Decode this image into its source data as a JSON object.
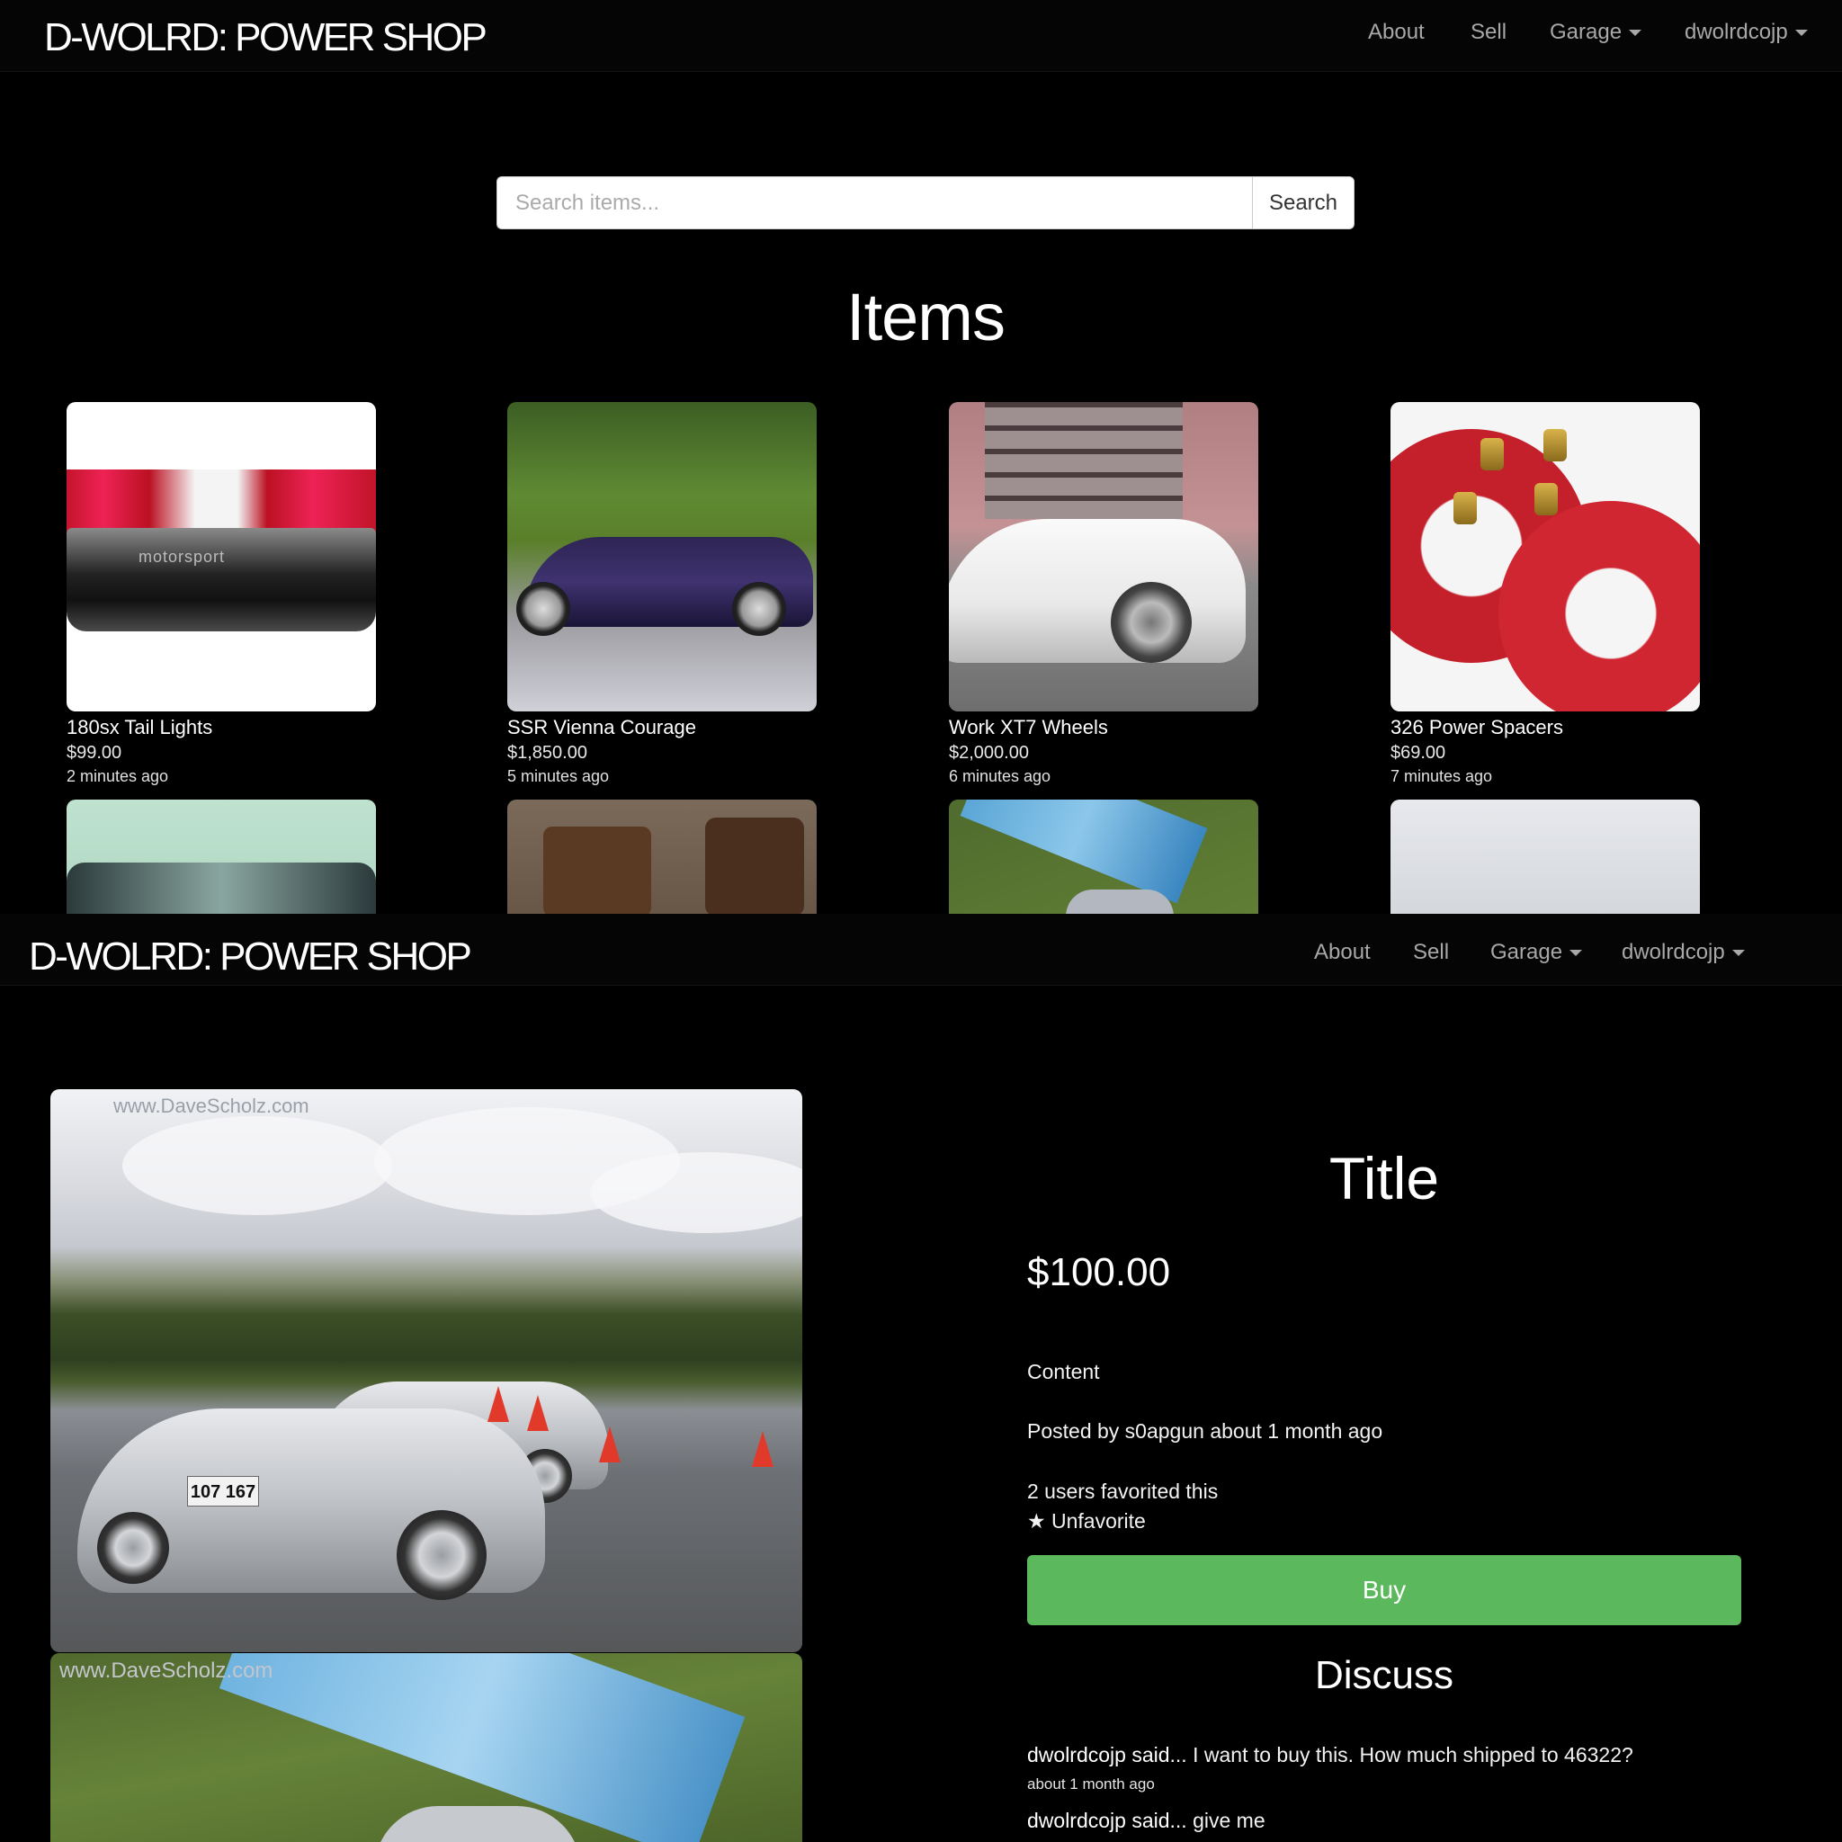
{
  "page1": {
    "navbar": {
      "brand": "D-WOLRD: POWER SHOP",
      "links": {
        "about": "About",
        "sell": "Sell",
        "garage": "Garage",
        "user": "dwolrdcojp"
      }
    },
    "search": {
      "placeholder": "Search items...",
      "button_label": "Search"
    },
    "heading": "Items",
    "items": [
      {
        "title": "180sx Tail Lights",
        "price": "$99.00",
        "time": "2 minutes ago",
        "thumb": "tail-lights-photo"
      },
      {
        "title": "SSR Vienna Courage",
        "price": "$1,850.00",
        "time": "5 minutes ago",
        "thumb": "purple-car-photo"
      },
      {
        "title": "Work XT7 Wheels",
        "price": "$2,000.00",
        "time": "6 minutes ago",
        "thumb": "white-car-photo"
      },
      {
        "title": "326 Power Spacers",
        "price": "$69.00",
        "time": "7 minutes ago",
        "thumb": "red-spacers-photo"
      }
    ],
    "partial_thumbs": [
      "headlight-photo",
      "rusty-parts-photo",
      "track-tarp-photo",
      "cloudy-hills-photo"
    ]
  },
  "page2": {
    "navbar": {
      "brand": "D-WOLRD: POWER SHOP",
      "links": {
        "about": "About",
        "sell": "Sell",
        "garage": "Garage",
        "user": "dwolrdcojp"
      }
    },
    "photo_watermark": "www.DaveScholz.com",
    "plate_number": "107 167",
    "item": {
      "title": "Title",
      "price": "$100.00",
      "content": "Content",
      "posted_by": "Posted by s0apgun about 1 month ago",
      "favorites": "2 users favorited this",
      "unfavorite_label": "★ Unfavorite",
      "buy_label": "Buy"
    },
    "discuss_heading": "Discuss",
    "comments": [
      {
        "author": "dwolrdcojp said...",
        "text": " I want to buy this. How much shipped to 46322?",
        "time": "about 1 month ago"
      },
      {
        "author": "dwolrdcojp said...",
        "text": " give me"
      }
    ]
  },
  "colors": {
    "background": "#000000",
    "buy_button": "#5cb85c",
    "nav_link": "#a8a8a8"
  }
}
